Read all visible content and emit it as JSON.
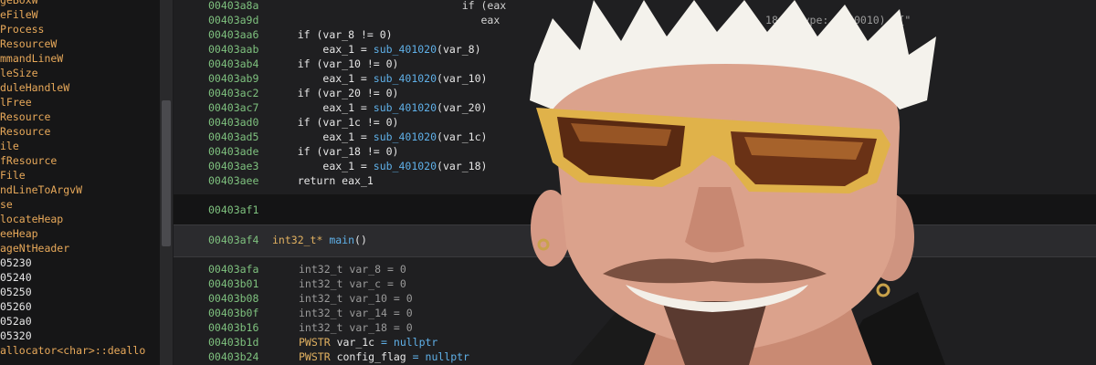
{
  "sidebar": {
    "items": [
      {
        "label": "geBoxW",
        "kind": "name"
      },
      {
        "label": "eFileW",
        "kind": "name"
      },
      {
        "label": "Process",
        "kind": "name"
      },
      {
        "label": "ResourceW",
        "kind": "name"
      },
      {
        "label": "mmandLineW",
        "kind": "name"
      },
      {
        "label": "leSize",
        "kind": "name"
      },
      {
        "label": "duleHandleW",
        "kind": "name"
      },
      {
        "label": "lFree",
        "kind": "name"
      },
      {
        "label": "Resource",
        "kind": "name"
      },
      {
        "label": "Resource",
        "kind": "name"
      },
      {
        "label": "ile",
        "kind": "name"
      },
      {
        "label": "fResource",
        "kind": "name"
      },
      {
        "label": "File",
        "kind": "name"
      },
      {
        "label": "ndLineToArgvW",
        "kind": "name"
      },
      {
        "label": "se",
        "kind": "name"
      },
      {
        "label": "locateHeap",
        "kind": "name"
      },
      {
        "label": "eeHeap",
        "kind": "name"
      },
      {
        "label": "ageNtHeader",
        "kind": "name"
      },
      {
        "label": "05230",
        "kind": "addr"
      },
      {
        "label": "05240",
        "kind": "addr"
      },
      {
        "label": "05250",
        "kind": "addr"
      },
      {
        "label": "05260",
        "kind": "addr"
      },
      {
        "label": "052a0",
        "kind": "addr"
      },
      {
        "label": "05320",
        "kind": "addr"
      },
      {
        "label": "allocator<char>::deallo",
        "kind": "name"
      }
    ]
  },
  "code": {
    "top_lines": [
      {
        "addr": "00403a8a",
        "indent": "                              ",
        "kw": "if (eax",
        "rest": ""
      },
      {
        "addr": "00403a9d",
        "indent": "                                 ",
        "kw": "eax",
        "rest": "                                          18, uType: 0x40010)  {\""
      }
    ],
    "block1": [
      {
        "addr": "00403aa6",
        "indent": "    ",
        "pre": "if (var_8 != 0)",
        "fn": "",
        "post": ""
      },
      {
        "addr": "00403aab",
        "indent": "        ",
        "pre": "eax_1 = ",
        "fn": "sub_401020",
        "post": "(var_8)"
      },
      {
        "addr": "00403ab4",
        "indent": "    ",
        "pre": "if (var_10 != 0)",
        "fn": "",
        "post": ""
      },
      {
        "addr": "00403ab9",
        "indent": "        ",
        "pre": "eax_1 = ",
        "fn": "sub_401020",
        "post": "(var_10)"
      },
      {
        "addr": "00403ac2",
        "indent": "    ",
        "pre": "if (var_20 != 0)",
        "fn": "",
        "post": ""
      },
      {
        "addr": "00403ac7",
        "indent": "        ",
        "pre": "eax_1 = ",
        "fn": "sub_401020",
        "post": "(var_20)"
      },
      {
        "addr": "00403ad0",
        "indent": "    ",
        "pre": "if (var_1c != 0)",
        "fn": "",
        "post": ""
      },
      {
        "addr": "00403ad5",
        "indent": "        ",
        "pre": "eax_1 = ",
        "fn": "sub_401020",
        "post": "(var_1c)"
      },
      {
        "addr": "00403ade",
        "indent": "    ",
        "pre": "if (var_18 != 0)",
        "fn": "",
        "post": ""
      },
      {
        "addr": "00403ae3",
        "indent": "        ",
        "pre": "eax_1 = ",
        "fn": "sub_401020",
        "post": "(var_18)"
      },
      {
        "addr": "00403aee",
        "indent": "    ",
        "pre": "return eax_1",
        "fn": "",
        "post": ""
      }
    ],
    "data_line": {
      "addr": "00403af1",
      "tail": ".@."
    },
    "func_header": {
      "addr": "00403af4",
      "type": "int32_t*",
      "name": "main",
      "suffix": "()"
    },
    "locals": [
      {
        "addr": "00403afa",
        "type": "int32_t",
        "name": "var_8",
        "value": "= 0",
        "muted": true
      },
      {
        "addr": "00403b01",
        "type": "int32_t",
        "name": "var_c",
        "value": "= 0",
        "muted": true
      },
      {
        "addr": "00403b08",
        "type": "int32_t",
        "name": "var_10",
        "value": "= 0",
        "muted": true
      },
      {
        "addr": "00403b0f",
        "type": "int32_t",
        "name": "var_14",
        "value": "= 0",
        "muted": true
      },
      {
        "addr": "00403b16",
        "type": "int32_t",
        "name": "var_18",
        "value": "= 0",
        "muted": true
      },
      {
        "addr": "00403b1d",
        "type": "PWSTR",
        "name": "var_1c",
        "value": "= nullptr",
        "muted": false
      },
      {
        "addr": "00403b24",
        "type": "PWSTR",
        "name": "config_flag",
        "value": "= nullptr",
        "muted": false
      }
    ]
  },
  "overlay": {
    "subject": "man-with-yellow-sunglasses-photo"
  }
}
